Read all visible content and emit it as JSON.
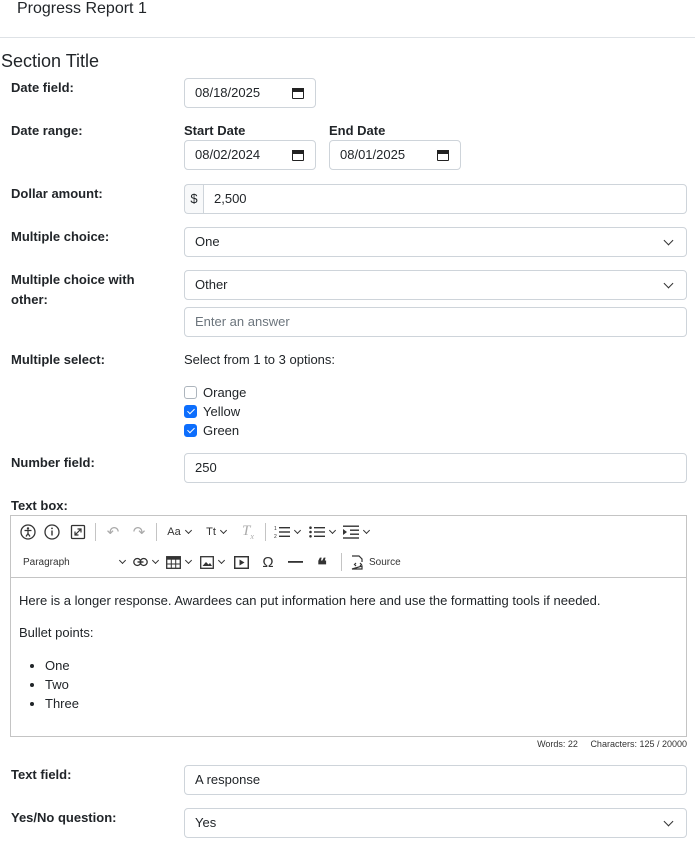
{
  "header": {
    "title": "Progress Report 1"
  },
  "section": {
    "title": "Section Title"
  },
  "fields": {
    "date": {
      "label": "Date field:",
      "value": "08/18/2025"
    },
    "date_range": {
      "label": "Date range:",
      "start_label": "Start Date",
      "start_value": "08/02/2024",
      "end_label": "End Date",
      "end_value": "08/01/2025"
    },
    "dollar": {
      "label": "Dollar amount:",
      "prefix": "$",
      "value": "2,500"
    },
    "multiple_choice": {
      "label": "Multiple choice:",
      "value": "One"
    },
    "multiple_choice_other": {
      "label_line1": "Multiple choice with",
      "label_line2": "other:",
      "value": "Other",
      "other_placeholder": "Enter an answer"
    },
    "multiple_select": {
      "label": "Multiple select:",
      "hint": "Select from 1 to 3 options:",
      "options": [
        {
          "label": "Orange",
          "checked": false
        },
        {
          "label": "Yellow",
          "checked": true
        },
        {
          "label": "Green",
          "checked": true
        }
      ]
    },
    "number": {
      "label": "Number field:",
      "value": "250"
    },
    "textbox": {
      "label": "Text box:",
      "paragraph_style": "Paragraph",
      "source_label": "Source",
      "font_size_label": "Aa",
      "font_style_label": "Tt",
      "paragraph1": "Here is a longer response. Awardees can put information here and use the formatting tools if needed.",
      "paragraph2": "Bullet points:",
      "bullets": [
        "One",
        "Two",
        "Three"
      ],
      "words": "Words: 22",
      "characters": "Characters: 125 / 20000"
    },
    "text_field": {
      "label": "Text field:",
      "value": "A response"
    },
    "yes_no": {
      "label": "Yes/No question:",
      "value": "Yes"
    }
  },
  "colors": {
    "accent": "#0d6efd",
    "border": "#ced4da"
  },
  "icons": [
    "calendar-icon",
    "chevron-down-icon",
    "accessibility-icon",
    "info-icon",
    "fullscreen-icon",
    "undo-icon",
    "redo-icon",
    "remove-format-icon",
    "numbered-list-icon",
    "bulleted-list-icon",
    "indent-icon",
    "link-icon",
    "table-icon",
    "image-icon",
    "media-icon",
    "special-char-icon",
    "horizontal-line-icon",
    "blockquote-icon",
    "source-icon"
  ]
}
